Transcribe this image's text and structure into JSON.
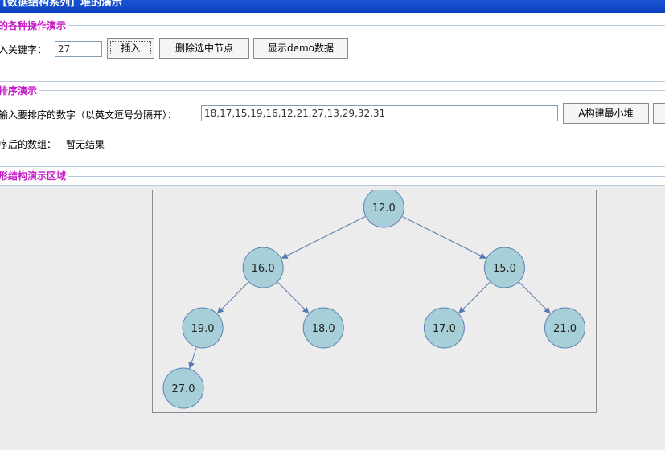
{
  "window": {
    "title": "【数据结构系列】堆的演示"
  },
  "operations": {
    "section_title": "的各种操作演示",
    "key_label": "入关键字：",
    "key_value": "27",
    "insert_button": "插入",
    "delete_button": "删除选中节点",
    "demo_button": "显示demo数据"
  },
  "sort": {
    "section_title": "排序演示",
    "input_label": "输入要排序的数字（以英文逗号分隔开）：",
    "input_value": "18,17,15,19,16,12,21,27,13,29,32,31",
    "build_min_heap_button": "A构建最小堆",
    "result_label": "序后的数组：",
    "result_value": "暂无结果"
  },
  "tree": {
    "section_title": "形结构演示区域",
    "node_fill": "#a7cfd8",
    "node_stroke": "#5c7fb5",
    "edge_color": "#5a78b0",
    "nodes": [
      {
        "id": "n0",
        "label": "12.0",
        "parent": null
      },
      {
        "id": "n1",
        "label": "16.0",
        "parent": "n0"
      },
      {
        "id": "n2",
        "label": "15.0",
        "parent": "n0"
      },
      {
        "id": "n3",
        "label": "19.0",
        "parent": "n1"
      },
      {
        "id": "n4",
        "label": "18.0",
        "parent": "n1"
      },
      {
        "id": "n5",
        "label": "17.0",
        "parent": "n2"
      },
      {
        "id": "n6",
        "label": "21.0",
        "parent": "n2"
      },
      {
        "id": "n7",
        "label": "27.0",
        "parent": "n3"
      }
    ]
  }
}
